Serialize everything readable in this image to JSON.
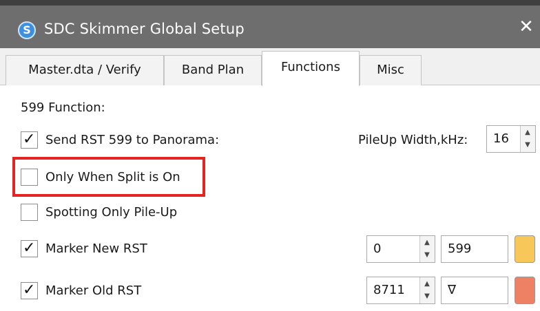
{
  "window": {
    "title": "SDC Skimmer Global Setup",
    "app_icon_letter": "S",
    "close_glyph": "✕"
  },
  "tabs": [
    {
      "label": "Master.dta / Verify",
      "active": false
    },
    {
      "label": "Band Plan",
      "active": false
    },
    {
      "label": "Functions",
      "active": true
    },
    {
      "label": "Misc",
      "active": false
    }
  ],
  "functions": {
    "section_label": "599 Function:",
    "send_rst": {
      "label": "Send RST 599 to Panorama:",
      "checked": true
    },
    "pileup_width": {
      "label": "PileUp Width,kHz:",
      "value": "16"
    },
    "only_when_split": {
      "label": "Only When Split is On",
      "checked": false,
      "highlighted": true
    },
    "spotting_only": {
      "label": "Spotting Only Pile-Up",
      "checked": false
    },
    "marker_new": {
      "label": "Marker New RST",
      "checked": true,
      "spin_value": "0",
      "text_value": "599",
      "color": "#f7c75a"
    },
    "marker_old": {
      "label": "Marker Old RST",
      "checked": true,
      "spin_value": "8711",
      "text_value": "∇",
      "color": "#ee8064"
    }
  },
  "glyphs": {
    "check": "✓",
    "up": "▲",
    "down": "▼"
  },
  "colors": {
    "highlight": "#e52421",
    "titlebar": "#6e6e6e",
    "app_icon": "#3d8fe0"
  }
}
